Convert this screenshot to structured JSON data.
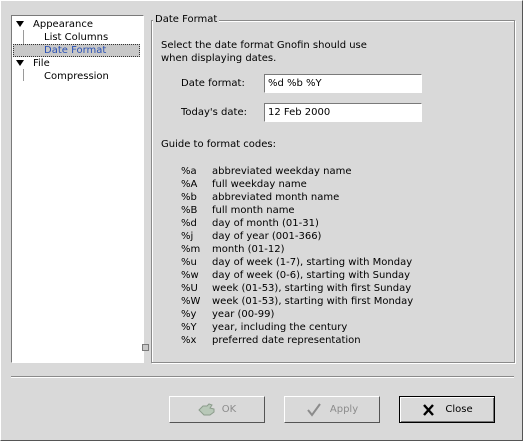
{
  "tree": {
    "items": [
      {
        "label": "Appearance",
        "expanded": true
      },
      {
        "label": "List Columns"
      },
      {
        "label": "Date Format",
        "selected": true
      },
      {
        "label": "File",
        "expanded": true
      },
      {
        "label": "Compression"
      }
    ]
  },
  "panel": {
    "title": "Date Format",
    "intro_line1": "Select the date format Gnofin should use",
    "intro_line2": "when displaying dates.",
    "date_format_label": "Date format:",
    "date_format_value": "%d %b %Y",
    "todays_date_label": "Today's date:",
    "todays_date_value": "12 Feb 2000",
    "guide_title": "Guide to format codes:",
    "codes": [
      {
        "code": "%a",
        "desc": "abbreviated weekday name"
      },
      {
        "code": "%A",
        "desc": "full weekday name"
      },
      {
        "code": "%b",
        "desc": "abbreviated month name"
      },
      {
        "code": "%B",
        "desc": "full month name"
      },
      {
        "code": "%d",
        "desc": "day of month (01-31)"
      },
      {
        "code": "%j",
        "desc": "day of year (001-366)"
      },
      {
        "code": "%m",
        "desc": "month (01-12)"
      },
      {
        "code": "%u",
        "desc": "day of week (1-7), starting with Monday"
      },
      {
        "code": "%w",
        "desc": "day of week (0-6), starting with Sunday"
      },
      {
        "code": "%U",
        "desc": "week (01-53), starting with first Sunday"
      },
      {
        "code": "%W",
        "desc": "week (01-53), starting with first Monday"
      },
      {
        "code": "%y",
        "desc": "year (00-99)"
      },
      {
        "code": "%Y",
        "desc": "year, including the century"
      },
      {
        "code": "%x",
        "desc": "preferred date representation"
      }
    ]
  },
  "buttons": {
    "ok": {
      "label": "OK",
      "icon": "ok-hand-icon",
      "enabled": false
    },
    "apply": {
      "label": "Apply",
      "icon": "checkmark-icon",
      "enabled": false
    },
    "close": {
      "label": "Close",
      "icon": "close-x-icon",
      "enabled": true
    }
  },
  "colors": {
    "selected_text": "#2a50b4",
    "background": "#d9d9d9"
  }
}
